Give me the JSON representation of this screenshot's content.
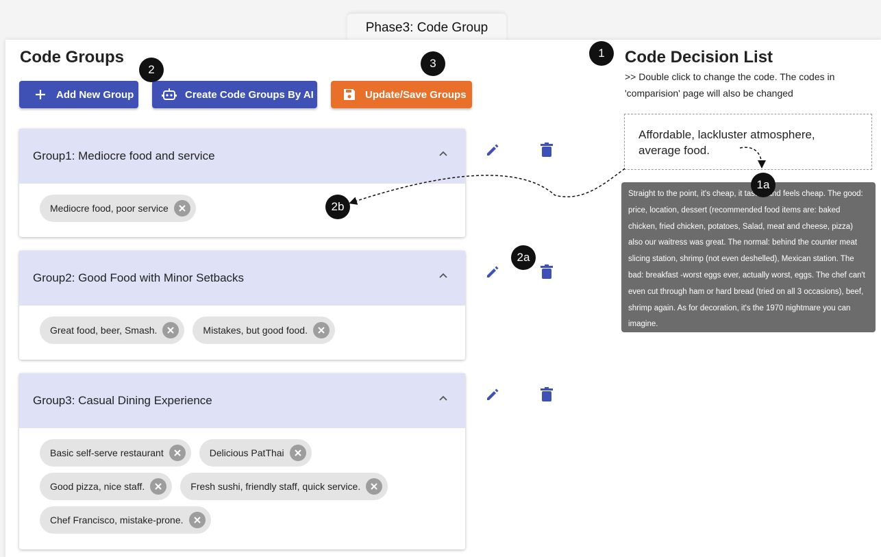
{
  "phase_tab": {
    "label": "Phase3: Code Group"
  },
  "code_groups": {
    "title": "Code Groups",
    "buttons": {
      "add": "Add New Group",
      "ai": "Create Code Groups By AI",
      "save": "Update/Save Groups"
    },
    "groups": [
      {
        "title": "Group1: Mediocre food and service",
        "codes": [
          [
            "Mediocre food, poor service"
          ]
        ]
      },
      {
        "title": "Group2: Good Food with Minor Setbacks",
        "codes": [
          [
            "Great food, beer, Smash.",
            "Mistakes, but good food."
          ]
        ]
      },
      {
        "title": "Group3: Casual Dining Experience",
        "codes": [
          [
            "Basic self-serve restaurant",
            "Delicious PatThai"
          ],
          [
            "Good pizza, nice staff.",
            "Fresh sushi, friendly staff, quick service."
          ],
          [
            "Chef Francisco, mistake-prone."
          ]
        ]
      }
    ]
  },
  "code_decision": {
    "title": "Code Decision List",
    "note": ">> Double click to change the code. The codes in 'comparision' page will also be changed",
    "selected_code": "Affordable, lackluster atmosphere, average food.",
    "tooltip_text": "Straight to the point, it's cheap, it tastes and feels cheap. The good: price, location, dessert (recommended food items are: baked chicken, fried chicken, potatoes, Salad, meat and cheese, pizza) also our waitress was great. The normal: behind the counter meat slicing station, shrimp (not even deshelled), Mexican station. The bad: breakfast -worst eggs ever, actually worst, eggs. The chef can't even cut through ham or hard bread (tried on all 3 occasions), beef, shrimp again. As for decoration, it's the 1970 nightmare you can imagine."
  },
  "annotations": [
    "1",
    "1a",
    "2",
    "2a",
    "2b",
    "3"
  ],
  "colors": {
    "primary": "#3f51b5",
    "accent": "#e8702b",
    "group_header": "#dfe1f6",
    "chip": "#e4e4e4",
    "tooltip": "#6c6c6c"
  },
  "icons": [
    "plus-icon",
    "robot-icon",
    "save-icon",
    "chevron-up-icon",
    "edit-icon",
    "delete-icon",
    "chip-remove-icon"
  ]
}
